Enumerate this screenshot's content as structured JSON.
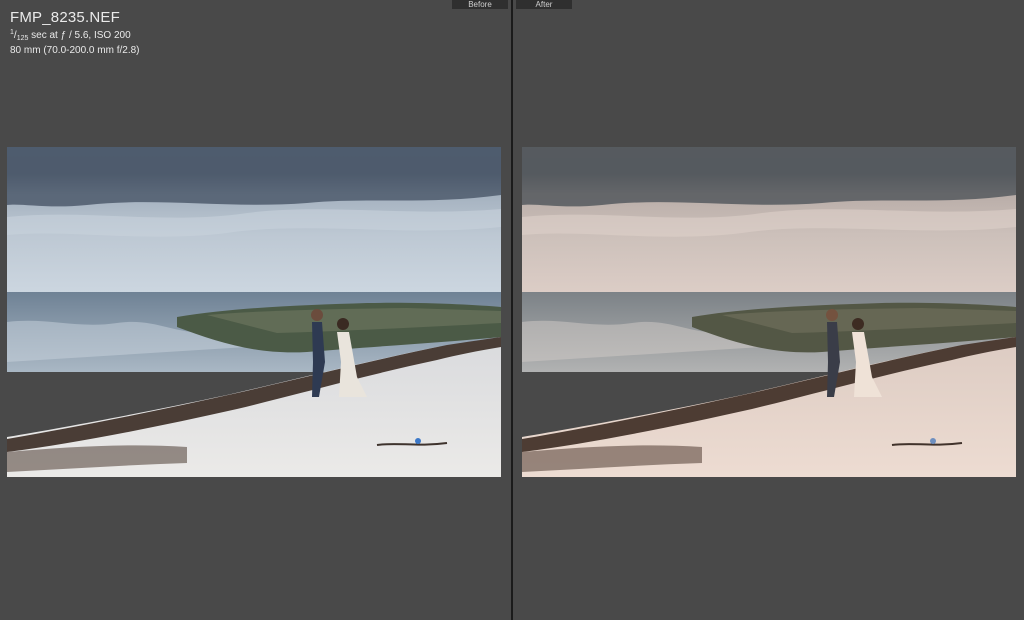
{
  "view": {
    "before_label": "Before",
    "after_label": "After"
  },
  "file_info": {
    "filename": "FMP_8235.NEF",
    "shutter_numerator": "1",
    "shutter_denominator": "125",
    "exposure_rest": " sec at ƒ / 5.6, ISO 200",
    "lens": "80 mm (70.0-200.0 mm f/2.8)"
  },
  "photos": {
    "before": {
      "sky_top": "#5b6a7b",
      "sky_mid": "#b7c3cf",
      "sky_low": "#ccd6e0",
      "sea": "#7f93a6",
      "sand": "#e2e1e0"
    },
    "after": {
      "sky_top": "#60656b",
      "sky_mid": "#c8bdb7",
      "sky_low": "#dcccc5",
      "sea": "#8a8f93",
      "sand": "#e8d8cf"
    }
  },
  "colors": {
    "background": "#494949",
    "divider": "#1b1b1b",
    "tab_bg": "#2f2f2f",
    "text": "#eaeaea"
  }
}
